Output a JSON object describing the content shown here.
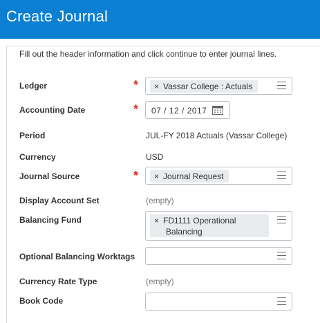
{
  "header": {
    "title": "Create Journal"
  },
  "instructions": "Fill out the header information and click continue to enter journal lines.",
  "fields": {
    "ledger": {
      "label": "Ledger",
      "value": "Vassar College : Actuals"
    },
    "accounting_date": {
      "label": "Accounting Date",
      "value": "07 / 12 / 2017"
    },
    "period": {
      "label": "Period",
      "value": "JUL-FY 2018 Actuals (Vassar College)"
    },
    "currency": {
      "label": "Currency",
      "value": "USD"
    },
    "journal_source": {
      "label": "Journal Source",
      "value": "Journal Request"
    },
    "display_account_set": {
      "label": "Display Account Set",
      "value": "(empty)"
    },
    "balancing_fund": {
      "label": "Balancing Fund",
      "value_line1": "FD1111 Operational",
      "value_line2": "Balancing"
    },
    "optional_balancing_worktags": {
      "label": "Optional Balancing Worktags"
    },
    "currency_rate_type": {
      "label": "Currency Rate Type",
      "value": "(empty)"
    },
    "book_code": {
      "label": "Book Code"
    }
  },
  "required_marker": "*",
  "pill_remove_glyph": "×",
  "icons": [
    "list-icon",
    "calendar-icon",
    "remove-icon"
  ],
  "colors": {
    "header_bg": "#0b7fd2",
    "required": "#de2c2c",
    "pill_bg": "#e8ecef"
  }
}
